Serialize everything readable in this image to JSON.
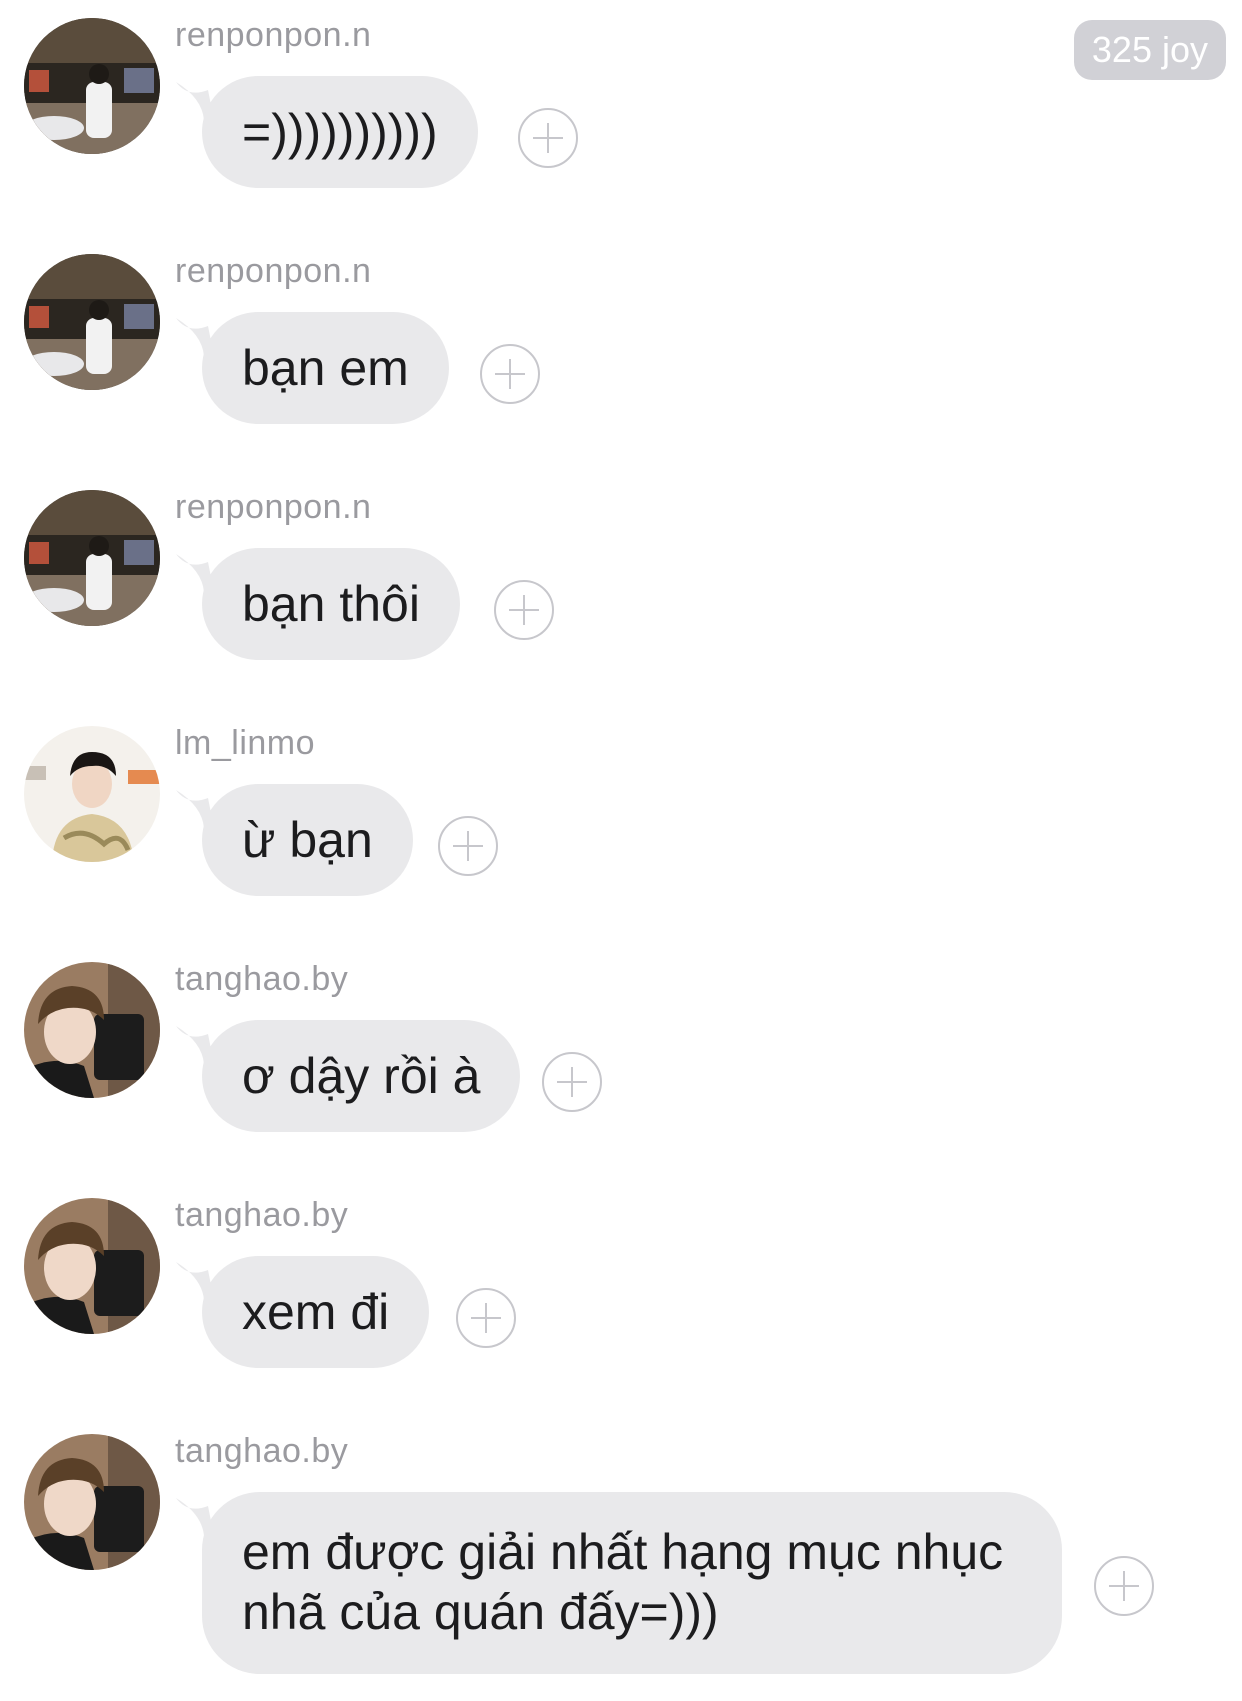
{
  "header": {
    "counter_label": "325 joy"
  },
  "messages": [
    {
      "sender": "renponpon.n",
      "text": "=))))))))))",
      "avatar": "avatar-renponpon"
    },
    {
      "sender": "renponpon.n",
      "text": "bạn em",
      "avatar": "avatar-renponpon"
    },
    {
      "sender": "renponpon.n",
      "text": "bạn thôi",
      "avatar": "avatar-renponpon"
    },
    {
      "sender": "lm_linmo",
      "text": "ừ bạn",
      "avatar": "avatar-linmo"
    },
    {
      "sender": "tanghao.by",
      "text": "ơ dậy rồi à",
      "avatar": "avatar-tanghao"
    },
    {
      "sender": "tanghao.by",
      "text": "xem đi",
      "avatar": "avatar-tanghao"
    },
    {
      "sender": "tanghao.by",
      "text": "em được giải nhất hạng mục nhục nhã của quán đấy=)))",
      "avatar": "avatar-tanghao"
    }
  ],
  "icons": {
    "reaction_button": "add-reaction-icon"
  },
  "colors": {
    "bubble_bg": "#e9e9eb",
    "bubble_text": "#1c1c1e",
    "username": "#9a9a9f",
    "badge_bg": "#d1d1d6",
    "reaction_outline": "#c7c7cc"
  }
}
